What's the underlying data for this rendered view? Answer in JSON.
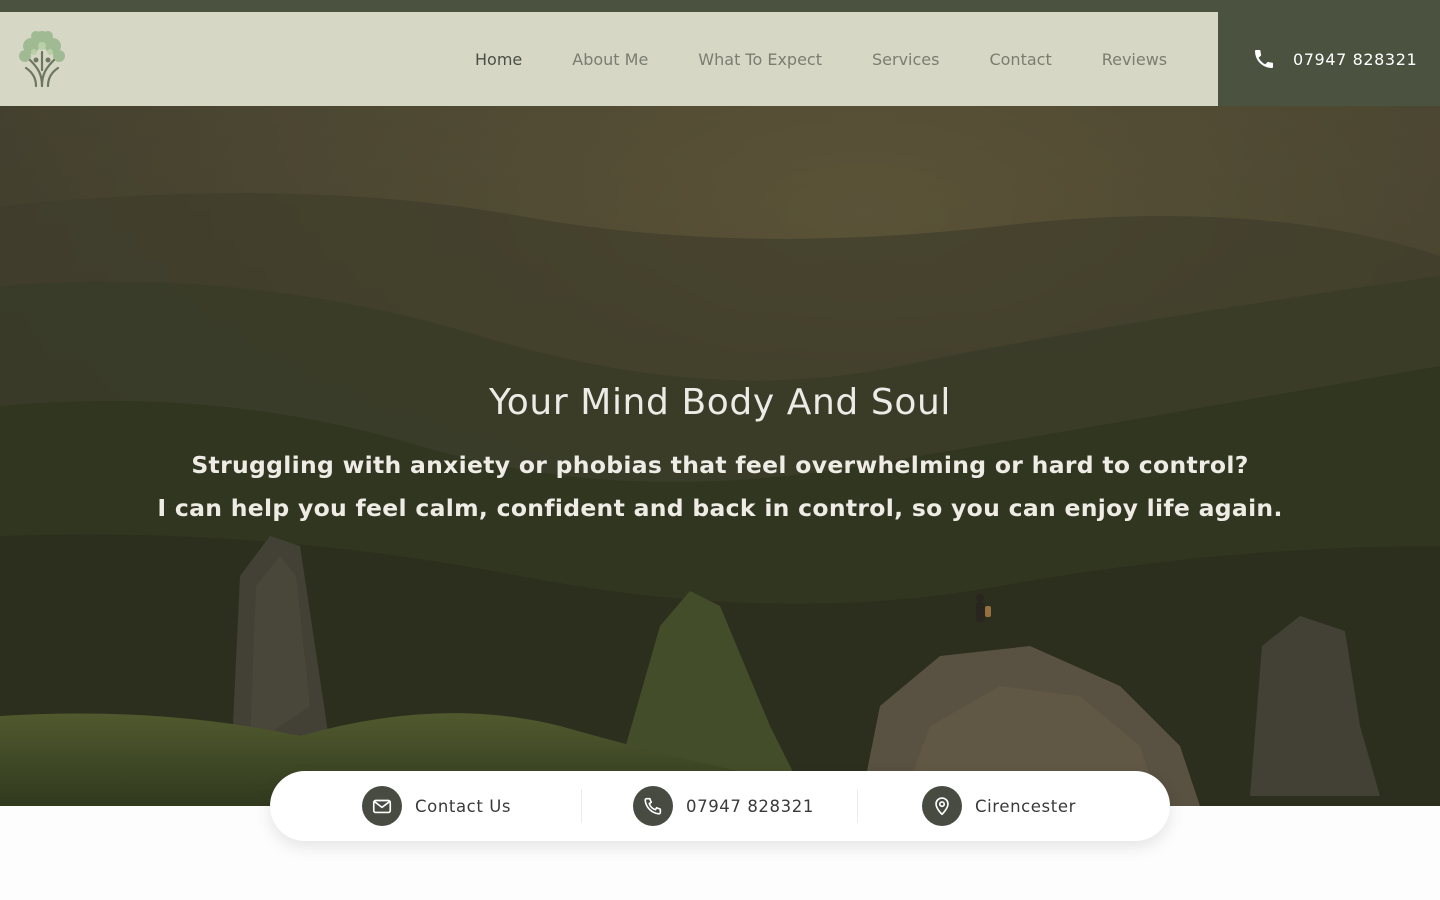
{
  "header": {
    "logo_icon": "tree-of-life-logo",
    "nav": [
      {
        "label": "Home",
        "active": true
      },
      {
        "label": "About Me",
        "active": false
      },
      {
        "label": "What To Expect",
        "active": false
      },
      {
        "label": "Services",
        "active": false
      },
      {
        "label": "Contact",
        "active": false
      },
      {
        "label": "Reviews",
        "active": false
      }
    ],
    "phone": {
      "icon": "phone-icon",
      "number": "07947 828321"
    }
  },
  "hero": {
    "title": "Your Mind Body And Soul",
    "line1": "Struggling with anxiety or phobias that feel overwhelming or hard to control?",
    "line2": "I can help you feel calm, confident and back in control, so you can enjoy life again.",
    "background": "misty mountain valley with rock pinnacles and a lone hiker"
  },
  "contact_bar": {
    "items": [
      {
        "icon": "envelope-icon",
        "label": "Contact Us"
      },
      {
        "icon": "phone-icon",
        "label": "07947 828321"
      },
      {
        "icon": "map-pin-icon",
        "label": "Cirencester"
      }
    ]
  },
  "colors": {
    "header_bg": "#d6d8c5",
    "accent_dark": "#4b5340",
    "nav_text": "#7a7d70",
    "nav_active": "#4b4f44",
    "icon_circle": "#474b41"
  }
}
